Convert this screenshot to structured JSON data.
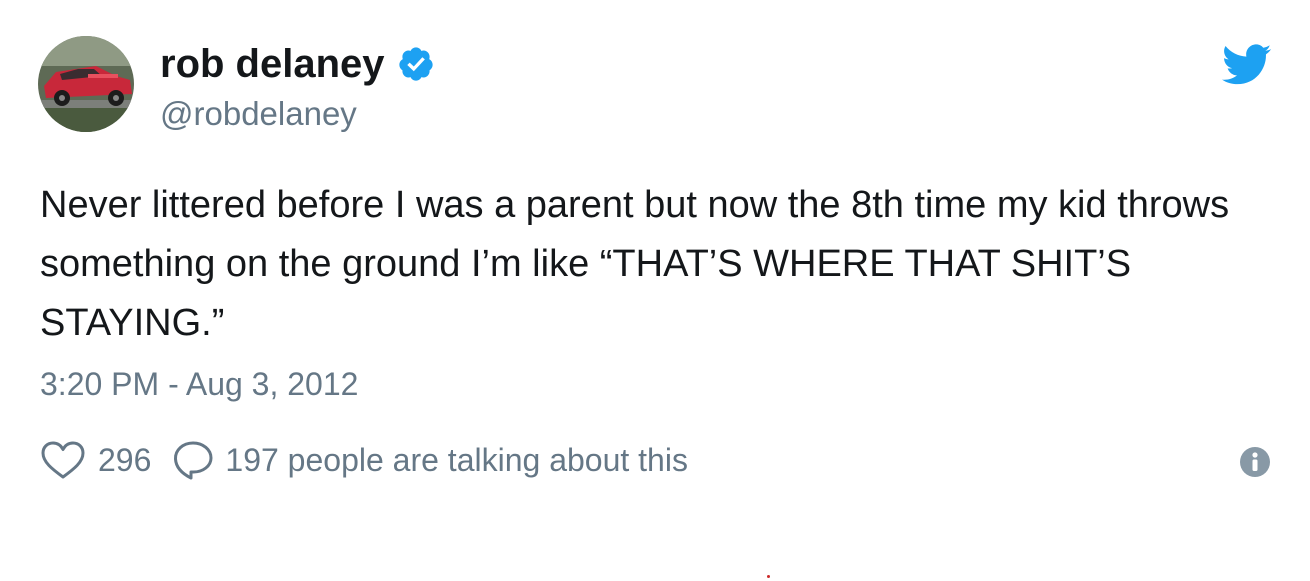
{
  "tweet": {
    "author": {
      "name": "rob delaney",
      "handle": "@robdelaney",
      "verified": true,
      "avatar_icon": "red-car-avatar"
    },
    "text": "Never littered before I was a parent but now the 8th time my kid throws something on the ground I’m like “THAT’S WHERE THAT SHIT’S STAYING.”",
    "timestamp": "3:20 PM - Aug 3, 2012",
    "likes": "296",
    "talking": "197 people are talking about this"
  },
  "icons": {
    "brand": "twitter-bird-icon",
    "verified": "verified-badge-icon",
    "like": "heart-icon",
    "reply": "speech-bubble-icon",
    "info": "info-icon"
  },
  "colors": {
    "brand": "#1da1f2",
    "text": "#14171a",
    "secondary": "#657786"
  }
}
